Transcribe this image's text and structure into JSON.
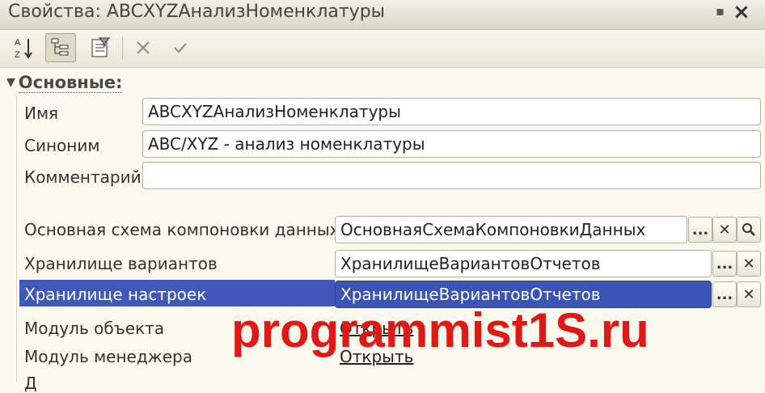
{
  "window": {
    "title": "Свойства: ABCXYZАнализНоменклатуры"
  },
  "section": {
    "title": "Основные:"
  },
  "fields": {
    "name": {
      "label": "Имя",
      "value": "ABCXYZАнализНоменклатуры"
    },
    "synonym": {
      "label": "Синоним",
      "value": "ABC/XYZ - анализ номенклатуры"
    },
    "comment": {
      "label": "Комментарий",
      "value": ""
    },
    "main_schema": {
      "label": "Основная схема компоновки данных",
      "value": "ОсновнаяСхемаКомпоновкиДанных"
    },
    "variants_storage": {
      "label": "Хранилище вариантов",
      "value": "ХранилищеВариантовОтчетов"
    },
    "settings_storage": {
      "label": "Хранилище настроек",
      "value": "ХранилищеВариантовОтчетов"
    },
    "object_module": {
      "label": "Модуль объекта",
      "link": "Открыть"
    },
    "manager_module": {
      "label": "Модуль менеджера",
      "link": "Открыть"
    }
  },
  "buttons": {
    "select": "...",
    "clear": "✕"
  },
  "watermark": "programmist1S.ru",
  "cut_label": "Д",
  "colors": {
    "selection": "#3b55b6",
    "watermark": "#e01818"
  }
}
